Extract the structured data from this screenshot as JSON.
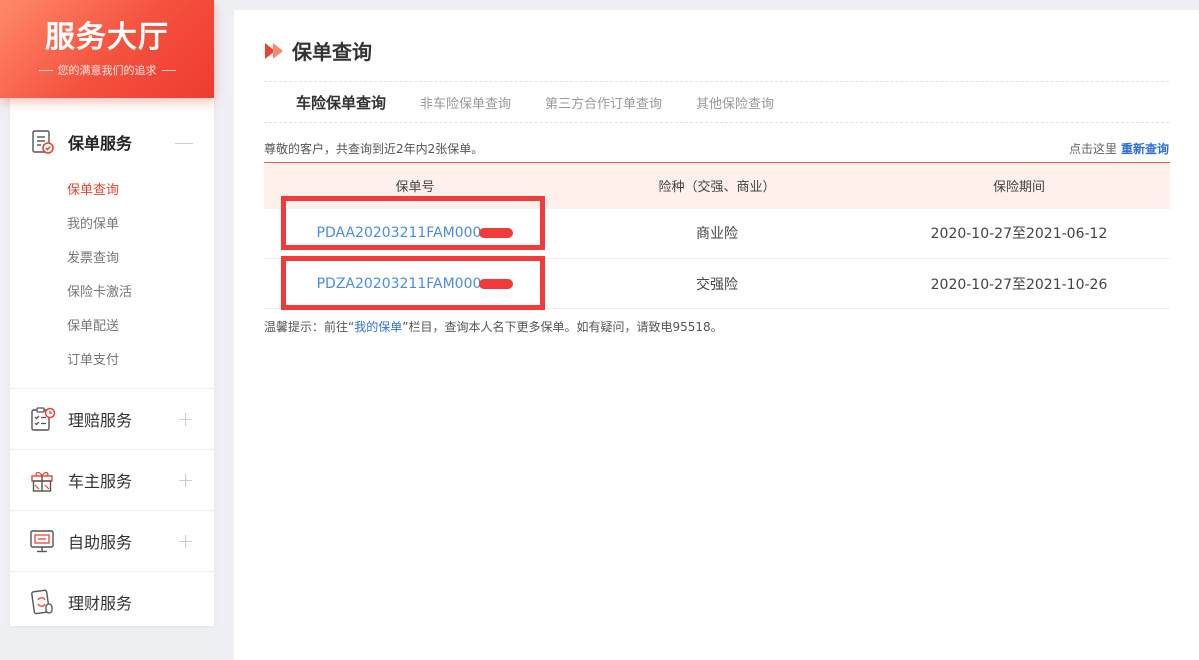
{
  "brand": {
    "title": "服务大厅",
    "subtitle": "您的满意我们的追求"
  },
  "menu": {
    "groups": [
      {
        "name": "policy-service",
        "title": "保单服务",
        "toggle": "—",
        "active": true,
        "items": [
          "保单查询",
          "我的保单",
          "发票查询",
          "保险卡激活",
          "保单配送",
          "订单支付"
        ]
      },
      {
        "name": "claims-service",
        "title": "理赔服务",
        "toggle": "+"
      },
      {
        "name": "owner-service",
        "title": "车主服务",
        "toggle": "+"
      },
      {
        "name": "self-service",
        "title": "自助服务",
        "toggle": "+"
      },
      {
        "name": "finance-service",
        "title": "理财服务"
      }
    ]
  },
  "main": {
    "title": "保单查询",
    "tabs": [
      "车险保单查询",
      "非车险保单查询",
      "第三方合作订单查询",
      "其他保险查询"
    ],
    "summary": "尊敬的客户，共查询到近2年内2张保单。",
    "requery_prefix": "点击这里",
    "requery_link": "重新查询",
    "table": {
      "headers": [
        "保单号",
        "险种（交强、商业）",
        "保险期间"
      ],
      "rows": [
        {
          "policy_no": "PDAA20203211FAM000",
          "type": "商业险",
          "period": "2020-10-27至2021-06-12"
        },
        {
          "policy_no": "PDZA20203211FAM000",
          "type": "交强险",
          "period": "2020-10-27至2021-10-26"
        }
      ]
    },
    "tip_prefix": "温馨提示：前往“",
    "tip_link": "我的保单",
    "tip_suffix": "”栏目，查询本人名下更多保单。如有疑问，请致电95518。"
  },
  "colors": {
    "accent": "#e8452f",
    "link": "#2f6fd8",
    "redaction": "#f23a3a",
    "header_bg": "#fff0ec"
  },
  "icons": [
    "policy-doc-icon",
    "claims-clipboard-icon",
    "gift-box-icon",
    "kiosk-screen-icon",
    "finance-card-icon",
    "double-arrow-icon"
  ]
}
